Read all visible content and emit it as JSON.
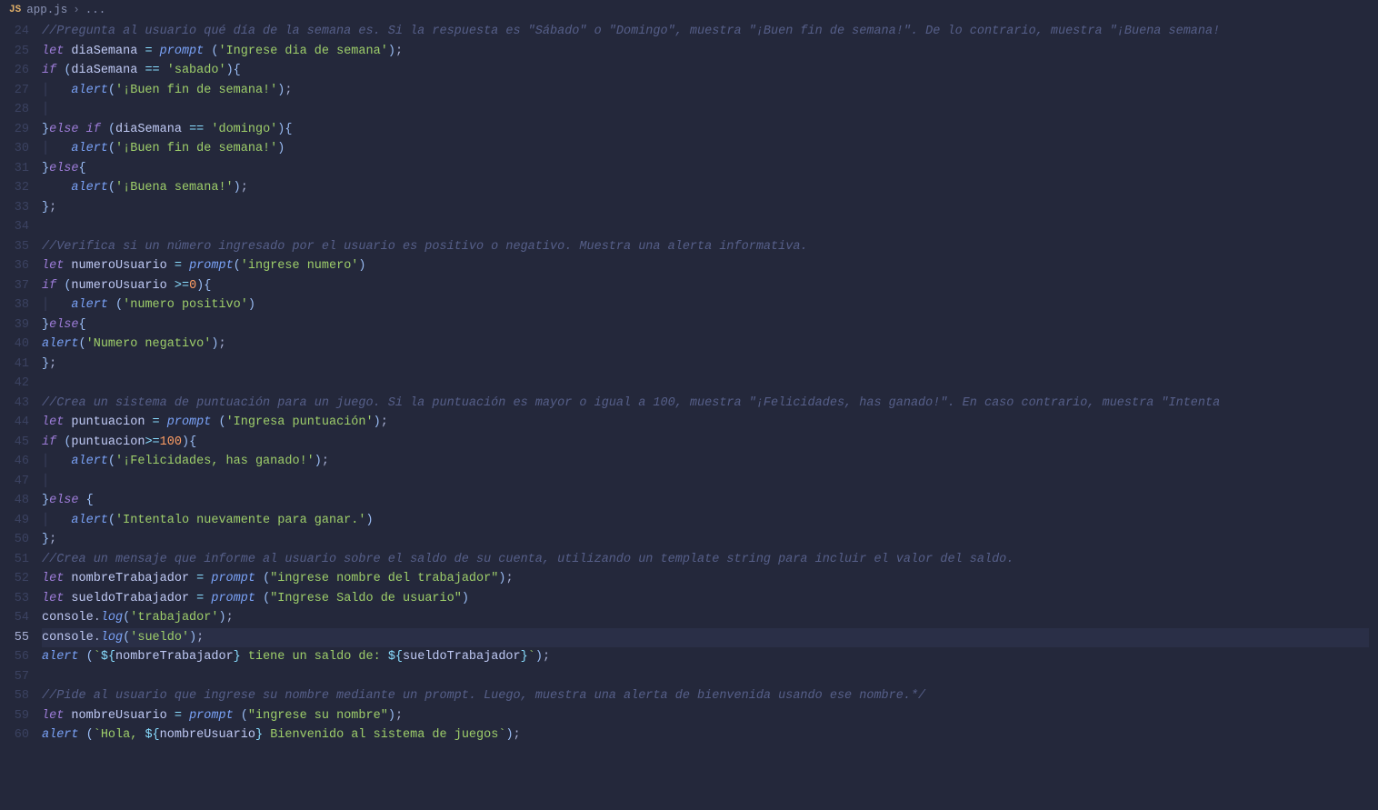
{
  "breadcrumb": {
    "badge": "JS",
    "file": "app.js",
    "sep": "›",
    "tail": "..."
  },
  "gutter": {
    "start": 24,
    "end": 60,
    "current": 55
  },
  "t": {
    "let": "let",
    "if": "if",
    "else": "else",
    "diaSemana": "diaSemana",
    "numeroUsuario": "numeroUsuario",
    "puntuacion": "puntuacion",
    "nombreTrabajador": "nombreTrabajador",
    "sueldoTrabajador": "sueldoTrabajador",
    "nombreUsuario": "nombreUsuario",
    "prompt": "prompt",
    "alert": "alert",
    "console": "console",
    "log": "log",
    "eq": " = ",
    "deq": " == ",
    "gte": " >=",
    "gte2": ">=",
    "op": "(",
    "cp": ")",
    "ob": "{",
    "cb": "}",
    "sc": ";",
    "dot": ".",
    "zero": "0",
    "hundred": "100",
    "c24": "//Pregunta al usuario qué día de la semana es. Si la respuesta es \"Sábado\" o \"Domingo\", muestra \"¡Buen fin de semana!\". De lo contrario, muestra \"¡Buena semana!",
    "s25": "'Ingrese dia de semana'",
    "s26": "'sabado'",
    "s27": "'¡Buen fin de semana!'",
    "s29": "'domingo'",
    "s30": "'¡Buen fin de semana!'",
    "s32": "'¡Buena semana!'",
    "c35": "//Verifica si un número ingresado por el usuario es positivo o negativo. Muestra una alerta informativa.",
    "s36": "'ingrese numero'",
    "s38": "'numero positivo'",
    "s40": "'Numero negativo'",
    "c43": "//Crea un sistema de puntuación para un juego. Si la puntuación es mayor o igual a 100, muestra \"¡Felicidades, has ganado!\". En caso contrario, muestra \"Intenta",
    "s44": "'Ingresa puntuación'",
    "s46": "'¡Felicidades, has ganado!'",
    "s49": "'Intentalo nuevamente para ganar.'",
    "c51": "//Crea un mensaje que informe al usuario sobre el saldo de su cuenta, utilizando un template string para incluir el valor del saldo.",
    "s52": "\"ingrese nombre del trabajador\"",
    "s53": "\"Ingrese Saldo de usuario\"",
    "s54": "'trabajador'",
    "s55": "'sueldo'",
    "l56a": "`",
    "l56b": " tiene un saldo de: ",
    "l56c": "`",
    "tmplO": "${",
    "tmplC": "}",
    "c58": "//Pide al usuario que ingrese su nombre mediante un prompt. Luego, muestra una alerta de bienvenida usando ese nombre.*/",
    "s59": "\"ingrese su nombre\"",
    "l60a": "`Hola, ",
    "l60b": " Bienvenido al sistema de juegos`"
  }
}
